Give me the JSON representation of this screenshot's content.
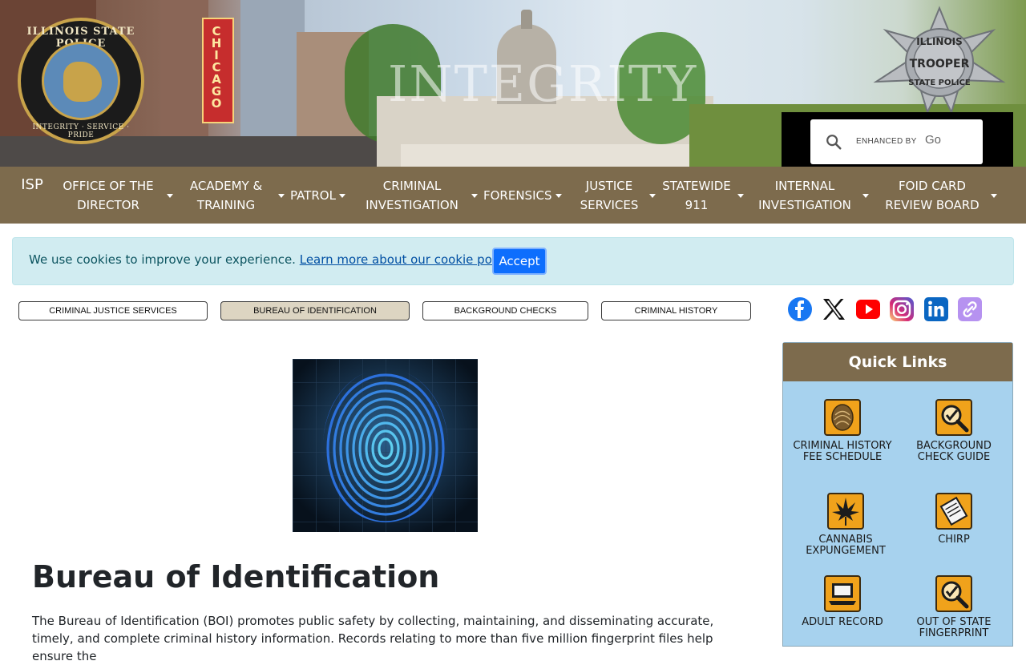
{
  "banner": {
    "banner_word": "INTEGRITY",
    "sign_word": "CHICAGO",
    "seal_top": "ILLINOIS STATE POLICE",
    "seal_bottom": "INTEGRITY · SERVICE · PRIDE",
    "badge_line1": "ILLINOIS",
    "badge_line2": "TROOPER",
    "badge_line3": "STATE POLICE"
  },
  "search": {
    "enhanced_by": "ENHANCED BY",
    "brand": "Go"
  },
  "nav": {
    "home": "ISP",
    "items": [
      {
        "label": "OFFICE OF THE DIRECTOR"
      },
      {
        "label": "ACADEMY & TRAINING"
      },
      {
        "label": "PATROL"
      },
      {
        "label": "CRIMINAL INVESTIGATION"
      },
      {
        "label": "FORENSICS"
      },
      {
        "label": "JUSTICE SERVICES"
      },
      {
        "label": "STATEWIDE 911"
      },
      {
        "label": "INTERNAL INVESTIGATION"
      },
      {
        "label": "FOID CARD REVIEW BOARD"
      }
    ]
  },
  "cookie": {
    "text": "We use cookies to improve your experience.",
    "link": "Learn more about our cookie policy",
    "period": ".",
    "accept": "Accept"
  },
  "subnav": {
    "items": [
      {
        "label": "CRIMINAL JUSTICE SERVICES"
      },
      {
        "label": "BUREAU OF IDENTIFICATION"
      },
      {
        "label": "BACKGROUND CHECKS"
      },
      {
        "label": "CRIMINAL HISTORY"
      }
    ]
  },
  "social": {
    "icons": [
      "facebook-icon",
      "x-icon",
      "youtube-icon",
      "instagram-icon",
      "linkedin-icon",
      "link-icon"
    ]
  },
  "main": {
    "title": "Bureau of Identification",
    "body": "The Bureau of Identification (BOI) promotes public safety by collecting, maintaining, and disseminating accurate, timely, and complete criminal history information. Records relating to more than five million fingerprint files help ensure the"
  },
  "quick_links": {
    "title": "Quick Links",
    "items": [
      {
        "label": "CRIMINAL HISTORY FEE SCHEDULE"
      },
      {
        "label": "BACKGROUND CHECK GUIDE"
      },
      {
        "label": "CANNABIS EXPUNGEMENT"
      },
      {
        "label": "CHIRP"
      },
      {
        "label": "ADULT RECORD"
      },
      {
        "label": "OUT OF STATE FINGERPRINT"
      }
    ]
  },
  "colors": {
    "nav_bg": "#7d6b4d",
    "cookie_bg": "#d1ecf1",
    "accept_bg": "#0d6efd",
    "quick_links_bg": "#a7d2ee",
    "active_pill": "#ddd5c2"
  }
}
